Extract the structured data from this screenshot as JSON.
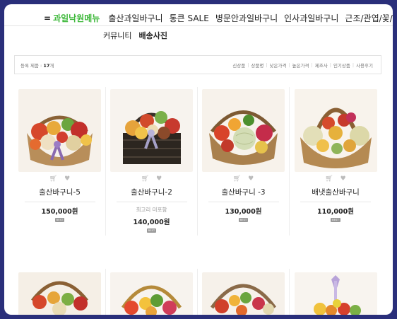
{
  "nav": {
    "menu_main": "과일낙원메뉴",
    "menu_glyph": "=",
    "items": [
      "출산과일바구니",
      "통큰 SALE",
      "병문안과일바구니",
      "인사과일바구니",
      "근조/관엽/꽃/난"
    ],
    "row2": [
      "커뮤니티",
      "배송사진"
    ]
  },
  "sortbar": {
    "count_label": "등록 제품 :",
    "count_value": "17",
    "count_unit": "개",
    "options": [
      "신상품",
      "상품명",
      "낮은가격",
      "높은가격",
      "제조사",
      "인기상품",
      "사용후기"
    ]
  },
  "products": [
    {
      "name": "출산바구니-5",
      "memo": "",
      "price": "150,000원",
      "badge": "BEST",
      "cart_icon": "cart-icon",
      "wish_icon": "heart-icon"
    },
    {
      "name": "출산바구니-2",
      "memo": "최고리 미포함",
      "price": "140,000원",
      "badge": "BEST",
      "cart_icon": "cart-icon",
      "wish_icon": "heart-icon"
    },
    {
      "name": "출산바구니 -3",
      "memo": "",
      "price": "130,000원",
      "badge": "BEST",
      "cart_icon": "cart-icon",
      "wish_icon": "heart-icon"
    },
    {
      "name": "배냇출산바구니",
      "memo": "",
      "price": "110,000원",
      "badge": "BEST",
      "cart_icon": "cart-icon",
      "wish_icon": "heart-icon"
    }
  ],
  "colors": {
    "frame": "#2a2f7a",
    "menu_accent": "#3db83a",
    "badge": "#9a9a9a"
  }
}
